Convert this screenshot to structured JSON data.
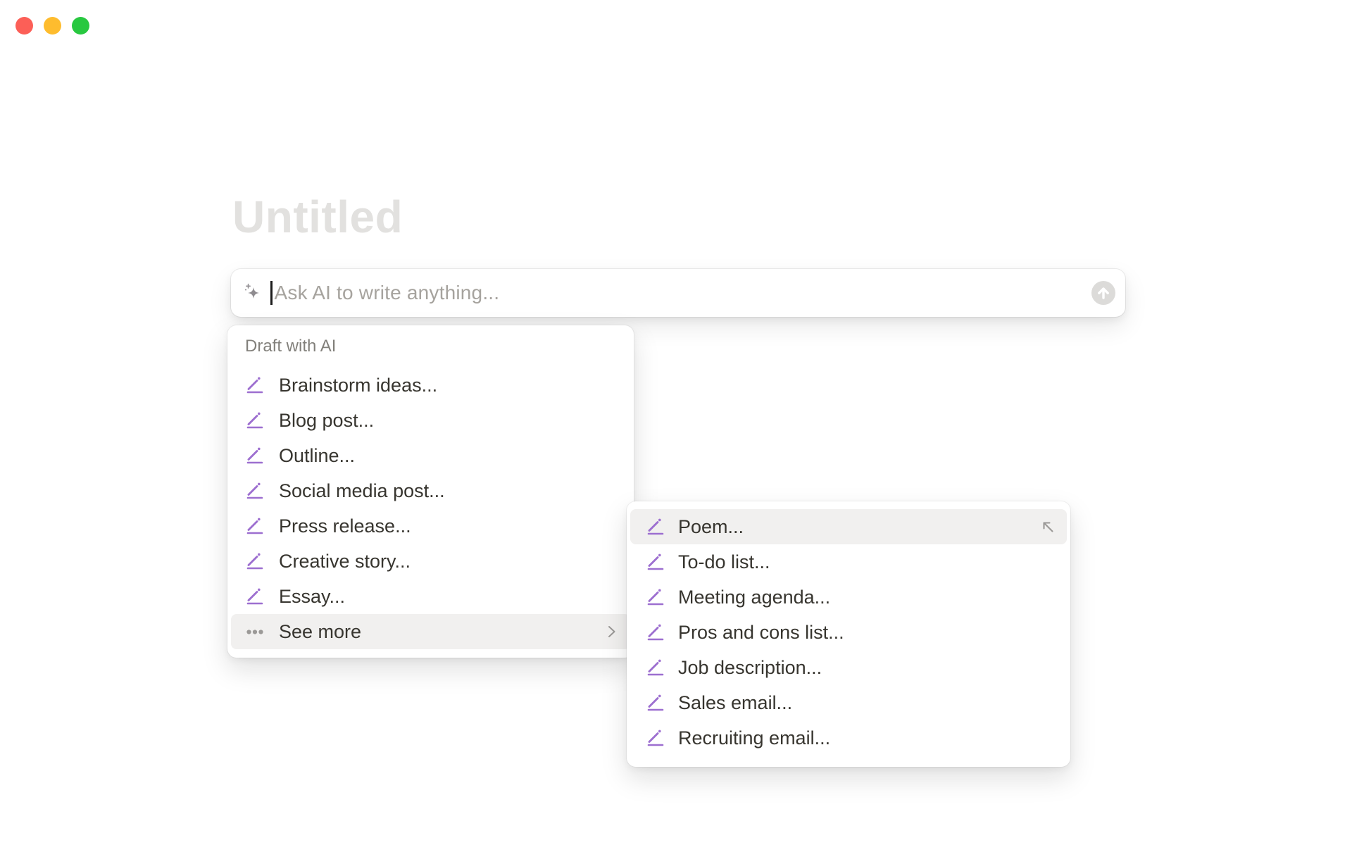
{
  "window": {
    "controls": [
      {
        "name": "close"
      },
      {
        "name": "minimize"
      },
      {
        "name": "zoom"
      }
    ]
  },
  "page": {
    "title_placeholder": "Untitled"
  },
  "ai_input": {
    "placeholder": "Ask AI to write anything...",
    "leading_icon": "ai-sparkle-icon",
    "submit_icon": "arrow-up-icon"
  },
  "draft_menu": {
    "header": "Draft with AI",
    "items": [
      {
        "label": "Brainstorm ideas...",
        "icon": "pencil-icon"
      },
      {
        "label": "Blog post...",
        "icon": "pencil-icon"
      },
      {
        "label": "Outline...",
        "icon": "pencil-icon"
      },
      {
        "label": "Social media post...",
        "icon": "pencil-icon"
      },
      {
        "label": "Press release...",
        "icon": "pencil-icon"
      },
      {
        "label": "Creative story...",
        "icon": "pencil-icon"
      },
      {
        "label": "Essay...",
        "icon": "pencil-icon"
      },
      {
        "label": "See more",
        "icon": "ellipsis-icon",
        "trailing_icon": "chevron-right-icon",
        "highlighted": true
      }
    ]
  },
  "submenu": {
    "items": [
      {
        "label": "Poem...",
        "icon": "pencil-icon",
        "trailing_icon": "arrow-up-left-icon",
        "highlighted": true
      },
      {
        "label": "To-do list...",
        "icon": "pencil-icon"
      },
      {
        "label": "Meeting agenda...",
        "icon": "pencil-icon"
      },
      {
        "label": "Pros and cons list...",
        "icon": "pencil-icon"
      },
      {
        "label": "Job description...",
        "icon": "pencil-icon"
      },
      {
        "label": "Sales email...",
        "icon": "pencil-icon"
      },
      {
        "label": "Recruiting email...",
        "icon": "pencil-icon"
      }
    ]
  },
  "colors": {
    "accent-purple": "#9d6fd0",
    "text-primary": "#37352f",
    "text-secondary": "#82807b",
    "placeholder": "#a6a39e",
    "title-placeholder": "#e2e1df",
    "highlight": "#f1f0ef",
    "icon-gray": "#9b9997",
    "submit-circle": "#dcdbd9",
    "traffic-red": "#fc5f57",
    "traffic-yellow": "#febc2e",
    "traffic-green": "#28c840"
  }
}
